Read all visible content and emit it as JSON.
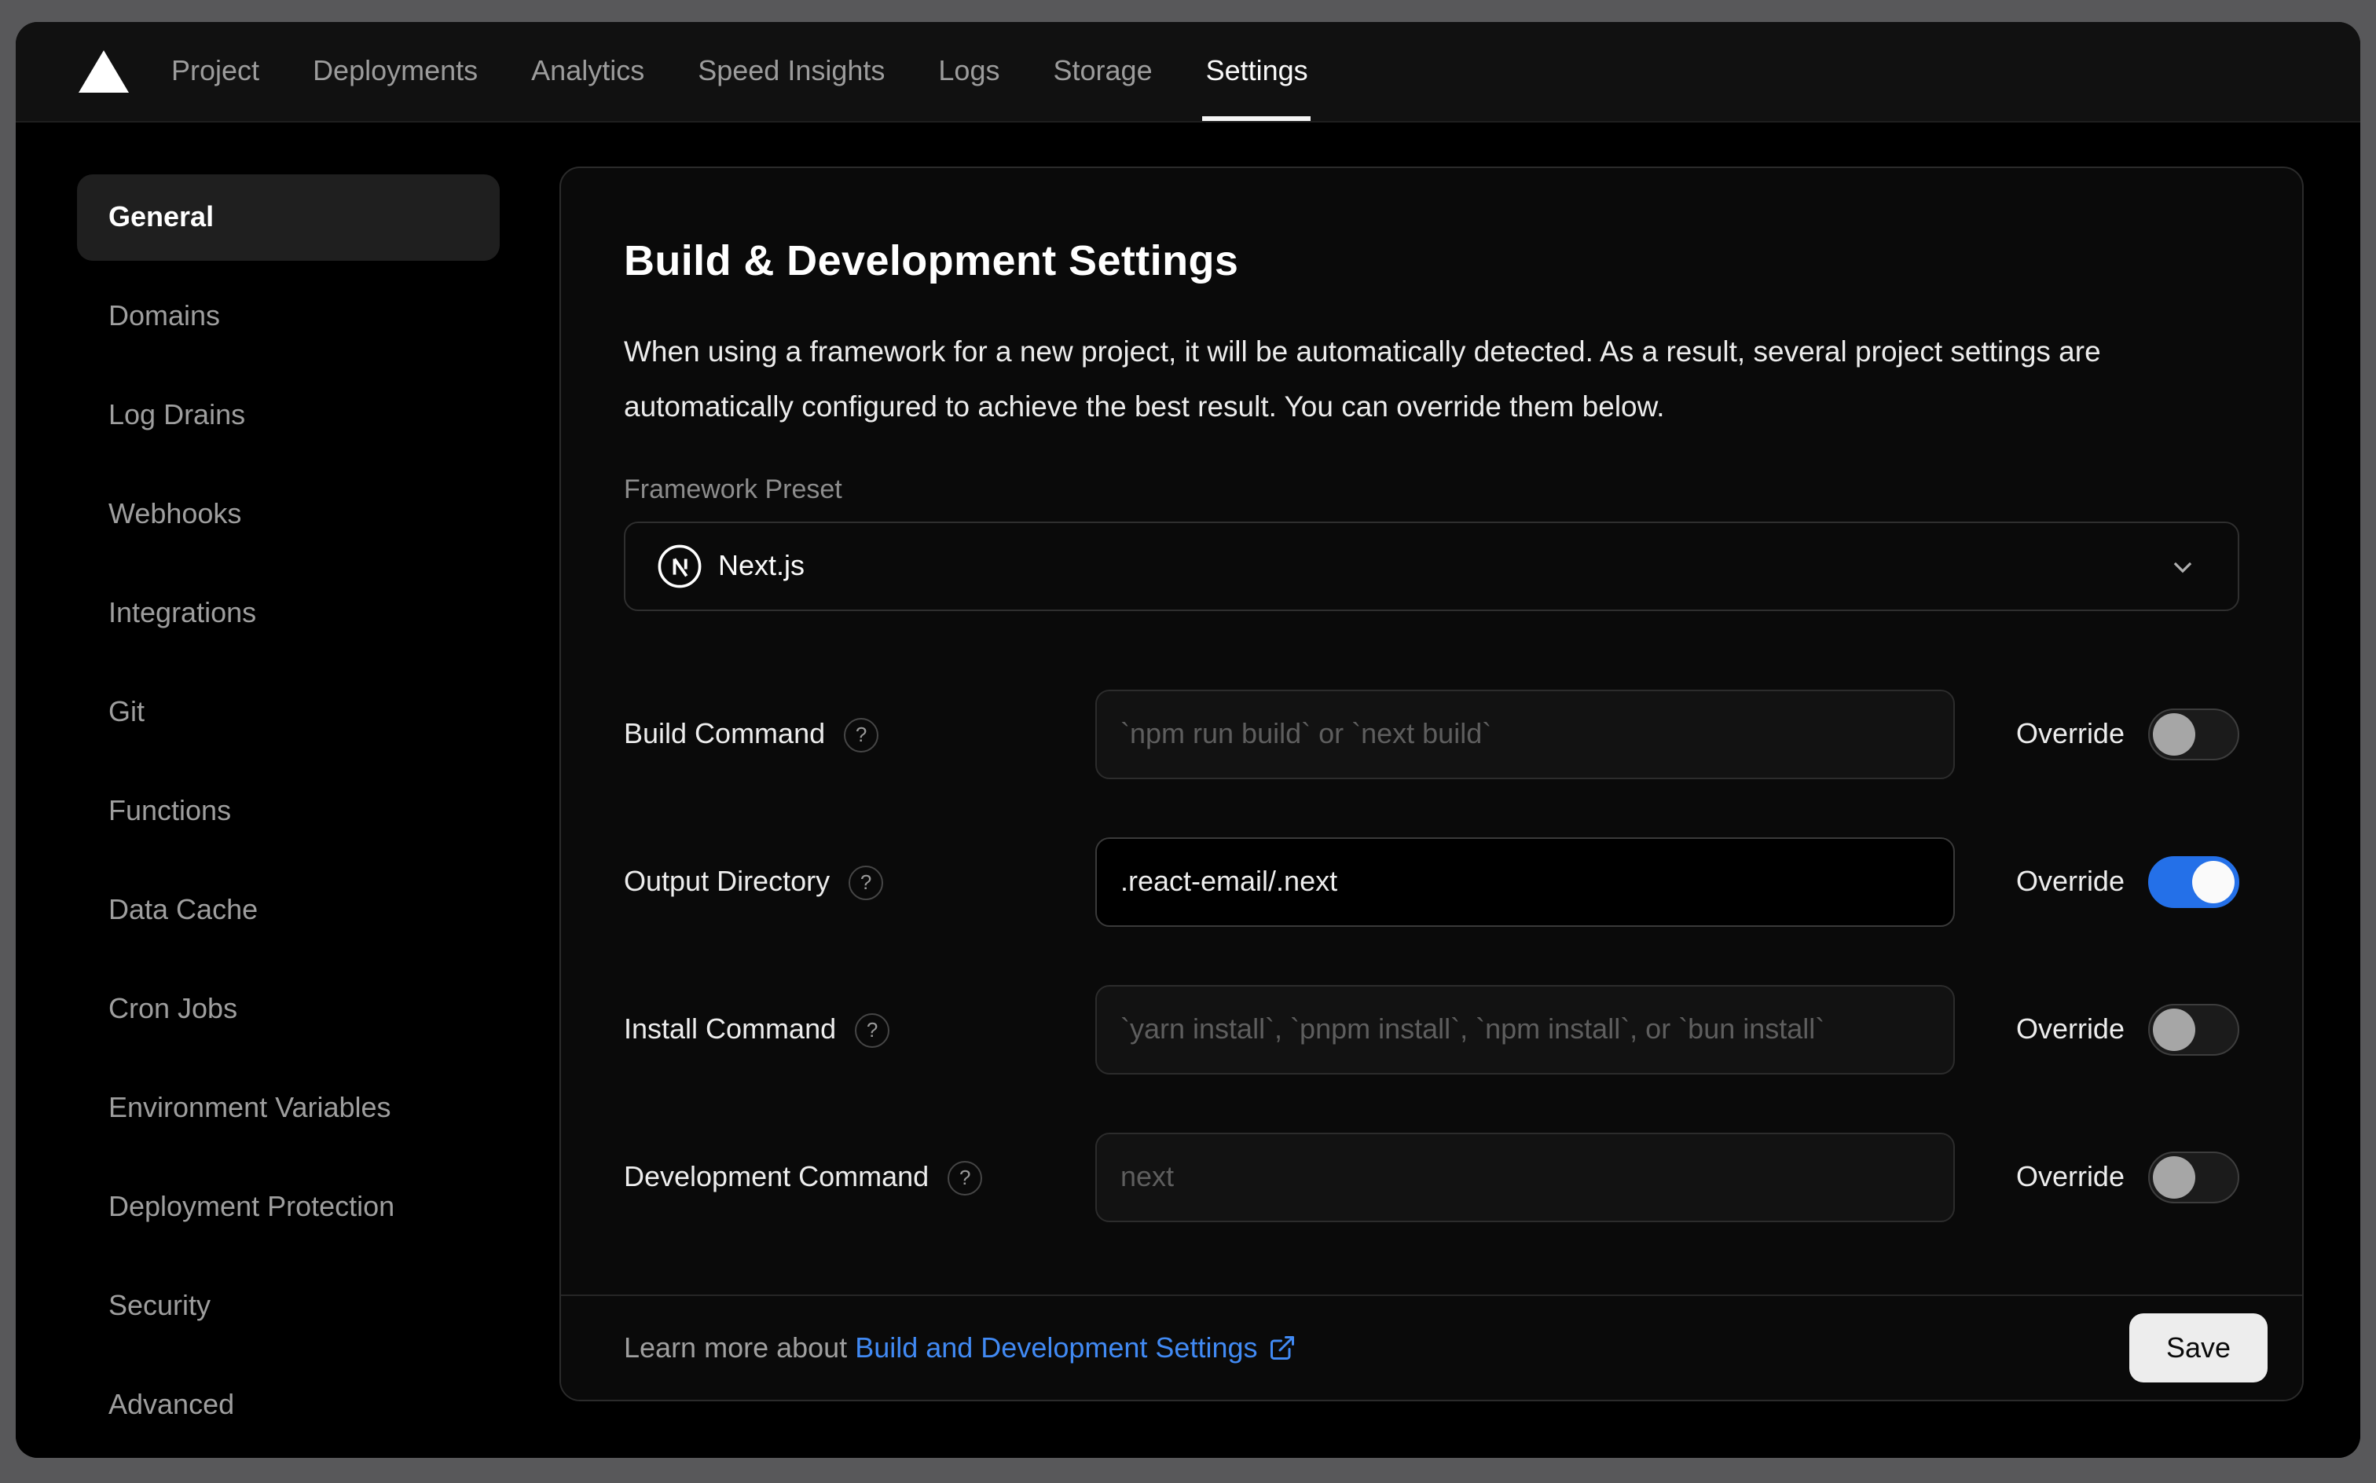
{
  "nav": {
    "items": [
      "Project",
      "Deployments",
      "Analytics",
      "Speed Insights",
      "Logs",
      "Storage",
      "Settings"
    ],
    "active": "Settings"
  },
  "sidebar": {
    "items": [
      "General",
      "Domains",
      "Log Drains",
      "Webhooks",
      "Integrations",
      "Git",
      "Functions",
      "Data Cache",
      "Cron Jobs",
      "Environment Variables",
      "Deployment Protection",
      "Security",
      "Advanced"
    ],
    "active": "General"
  },
  "panel": {
    "title": "Build & Development Settings",
    "description": "When using a framework for a new project, it will be automatically detected. As a result, several project settings are automatically configured to achieve the best result. You can override them below.",
    "framework_label": "Framework Preset",
    "framework_value": "Next.js",
    "override_label": "Override",
    "rows": [
      {
        "label": "Build Command",
        "placeholder": "`npm run build` or `next build`",
        "value": "",
        "override": false
      },
      {
        "label": "Output Directory",
        "placeholder": "",
        "value": ".react-email/.next",
        "override": true
      },
      {
        "label": "Install Command",
        "placeholder": "`yarn install`, `pnpm install`, `npm install`, or `bun install`",
        "value": "",
        "override": false
      },
      {
        "label": "Development Command",
        "placeholder": "next",
        "value": "",
        "override": false
      }
    ],
    "footer": {
      "prefix": "Learn more about ",
      "link_text": "Build and Development Settings",
      "save_label": "Save"
    }
  },
  "colors": {
    "toggle_on_blue": "#2470e8",
    "link_blue": "#418af4",
    "card_background": "#0a0a0a",
    "page_background": "#000000"
  }
}
